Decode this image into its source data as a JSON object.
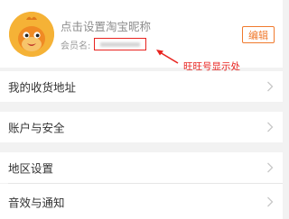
{
  "profile": {
    "nickname_prompt": "点击设置淘宝昵称",
    "member_label": "会员名:",
    "member_value": "",
    "edit_label": "编辑"
  },
  "annotation": {
    "text": "旺旺号显示处",
    "color": "#e8231f"
  },
  "menu": {
    "items": [
      {
        "label": "我的收货地址",
        "icon": "chevron-right-icon"
      },
      {
        "label": "账户与安全",
        "icon": "chevron-right-icon"
      },
      {
        "label": "地区设置",
        "icon": "chevron-right-icon"
      },
      {
        "label": "音效与通知",
        "icon": "chevron-right-icon"
      }
    ]
  },
  "colors": {
    "accent": "#f07a2e",
    "background": "#f2f2f2",
    "avatar": "#f5b236"
  }
}
